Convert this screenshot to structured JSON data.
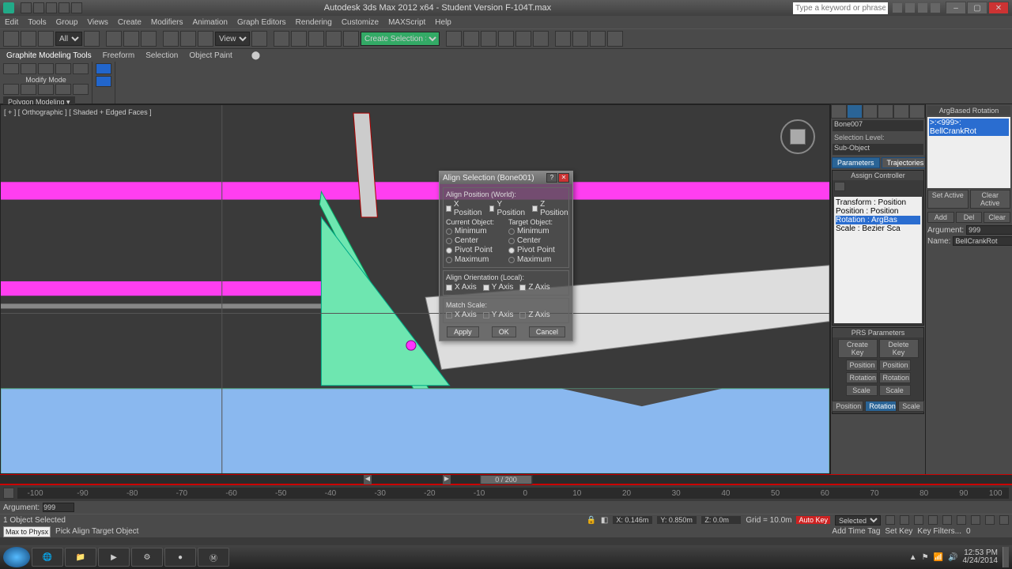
{
  "title": "Autodesk 3ds Max 2012 x64 - Student Version   F-104T.max",
  "search_placeholder": "Type a keyword or phrase",
  "menus": [
    "Edit",
    "Tools",
    "Group",
    "Views",
    "Create",
    "Modifiers",
    "Animation",
    "Graph Editors",
    "Rendering",
    "Customize",
    "MAXScript",
    "Help"
  ],
  "toolbar": {
    "dd1": "All",
    "dd2": "View",
    "dd3": "Create Selection Se"
  },
  "ribbon_tabs": [
    "Graphite Modeling Tools",
    "Freeform",
    "Selection",
    "Object Paint"
  ],
  "modify_mode": "Modify Mode",
  "poly_dd": "Polygon Modeling ▾",
  "viewport_label": "[ + ] [ Orthographic ] [ Shaded + Edged Faces ]",
  "timeslider": "0 / 200",
  "ruler": [
    "-100",
    "-90",
    "-80",
    "-70",
    "-60",
    "-50",
    "-40",
    "-30",
    "-20",
    "-10",
    "0",
    "10",
    "20",
    "30",
    "40",
    "50",
    "60",
    "70",
    "80",
    "90",
    "100"
  ],
  "arg_label": "Argument:",
  "arg_val": "999",
  "status": {
    "sel": "1 Object Selected",
    "x": "X: 0.146m",
    "y": "Y: 0.850m",
    "z": "Z: 0.0m",
    "grid": "Grid = 10.0m",
    "autokey": "Auto Key",
    "selected": "Selected",
    "setkey": "Set Key",
    "keyf": "Key Filters...",
    "spin": "0"
  },
  "status2": {
    "maxphys": "Max to Physx",
    "prompt": "Pick Align Target Object",
    "addtime": "Add Time Tag"
  },
  "taskbar": {
    "time": "12:53 PM",
    "date": "4/24/2014"
  },
  "cmd": {
    "obj": "Bone007",
    "sel_lbl": "Selection Level:",
    "sub": "Sub-Object",
    "params": "Parameters",
    "traj": "Trajectories",
    "assign": "Assign Controller",
    "tree": [
      "Transform : Position",
      "  Position : Position",
      "  Rotation : ArgBas",
      "  Scale : Bezier Sca"
    ],
    "prs_h": "PRS Parameters",
    "create": "Create Key",
    "delete": "Delete Key",
    "pos": "Position",
    "rot": "Rotation",
    "scl": "Scale"
  },
  "side": {
    "h": "ArgBased Rotation",
    "item": ">:<999>: BellCrankRot",
    "setact": "Set Active",
    "clract": "Clear Active",
    "add": "Add",
    "del": "Del",
    "clr": "Clear",
    "argl": "Argument:",
    "argv": "999",
    "namel": "Name:",
    "namev": "BellCrankRot"
  },
  "dialog": {
    "title": "Align Selection (Bone001)",
    "g1": "Align Position (World):",
    "xp": "X Position",
    "yp": "Y Position",
    "zp": "Z Position",
    "cur": "Current Object:",
    "tgt": "Target Object:",
    "min": "Minimum",
    "ctr": "Center",
    "pp": "Pivot Point",
    "max": "Maximum",
    "g2": "Align Orientation (Local):",
    "xa": "X Axis",
    "ya": "Y Axis",
    "za": "Z Axis",
    "g3": "Match Scale:",
    "apply": "Apply",
    "ok": "OK",
    "cancel": "Cancel"
  }
}
